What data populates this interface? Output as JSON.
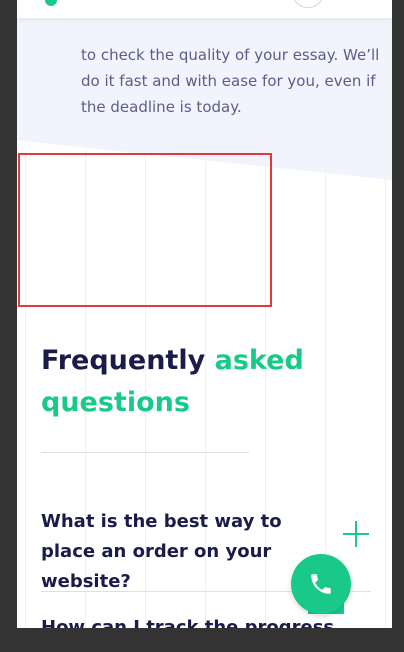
{
  "hero": {
    "body_text": "to check the quality of your essay. We’ll do it fast and with ease for you, even if the deadline is today."
  },
  "header": {
    "logo_icon": "logo-dot-icon",
    "menu_icon": "hamburger-menu-icon"
  },
  "faq": {
    "title_part1": "Frequently",
    "title_accent": "asked questions",
    "items": [
      {
        "question": "What is the best way to place an order on your website?",
        "icon": "plus-icon"
      },
      {
        "question": "How can I track the progress"
      }
    ]
  },
  "call_button": {
    "icon": "phone-icon"
  },
  "colors": {
    "accent": "#19c98a",
    "heading": "#191c4a",
    "text": "#5a5e87",
    "hero_bg": "#f2f4fd",
    "outer": "#333333",
    "highlight": "#e23a3a"
  }
}
